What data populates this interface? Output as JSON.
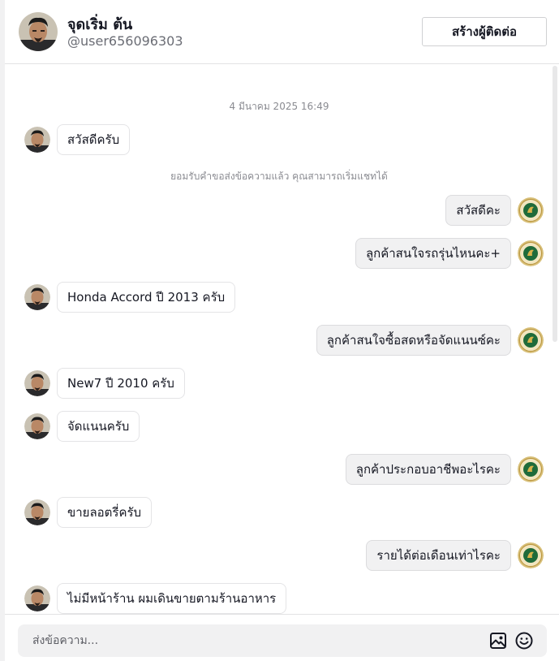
{
  "header": {
    "name": "จุดเริ่ม ต้น",
    "handle": "@user656096303",
    "create_contact_label": "สร้างผู้ติดต่อ",
    "avatar_icon": "user-avatar-photo"
  },
  "chat": {
    "timestamp": "4 มีนาคม 2025 16:49",
    "system_notice": "ยอมรับคำขอส่งข้อความแล้ว คุณสามารถเริ่มแชทได้",
    "messages": [
      {
        "sender": "contact",
        "text": "สวัสดีครับ"
      },
      {
        "sender": "me",
        "text": "สวัสดีคะ"
      },
      {
        "sender": "me",
        "text": "ลูกค้าสนใจรถรุ่นไหนคะ+"
      },
      {
        "sender": "contact",
        "text": "Honda Accord ปี 2013 ครับ"
      },
      {
        "sender": "me",
        "text": "ลูกค้าสนใจซื้อสดหรือจัดแนนซ์คะ"
      },
      {
        "sender": "contact",
        "text": "New7 ปี 2010 ครับ"
      },
      {
        "sender": "contact",
        "text": "จัดแนนครับ"
      },
      {
        "sender": "me",
        "text": "ลูกค้าประกอบอาชีพอะไรคะ"
      },
      {
        "sender": "contact",
        "text": "ขายลอตรี่ครับ"
      },
      {
        "sender": "me",
        "text": "รายได้ต่อเดือนเท่าไรคะ"
      },
      {
        "sender": "contact",
        "text": "ไม่มีหน้าร้าน ผมเดินขายตามร้านอาหาร"
      }
    ]
  },
  "composer": {
    "placeholder": "ส่งข้อความ...",
    "image_icon": "image-icon",
    "emoji_icon": "emoji-icon"
  },
  "colors": {
    "my_avatar_ring": "#c9a24a",
    "my_avatar_inner": "#1f6b3a",
    "border": "#e3e3e4"
  }
}
